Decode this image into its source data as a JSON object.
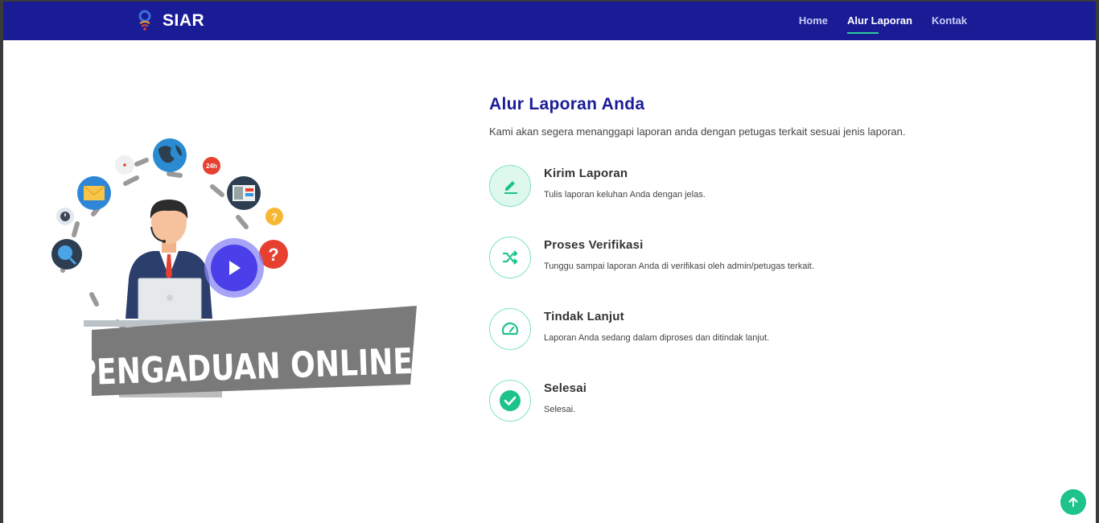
{
  "header": {
    "brand": "SIAR",
    "nav": [
      {
        "label": "Home"
      },
      {
        "label": "Alur Laporan"
      },
      {
        "label": "Kontak"
      }
    ]
  },
  "illustration": {
    "banner_text": "PENGADUAN ONLINE",
    "badge_24h": "24h"
  },
  "main": {
    "title": "Alur Laporan Anda",
    "description": "Kami akan segera menanggapi laporan anda dengan petugas terkait sesuai jenis laporan.",
    "steps": [
      {
        "title": "Kirim Laporan",
        "description": "Tulis laporan keluhan Anda dengan jelas.",
        "icon": "pencil-icon"
      },
      {
        "title": "Proses Verifikasi",
        "description": "Tunggu sampai laporan Anda di verifikasi oleh admin/petugas terkait.",
        "icon": "shuffle-icon"
      },
      {
        "title": "Tindak Lanjut",
        "description": "Laporan Anda sedang dalam diproses dan ditindak lanjut.",
        "icon": "speedometer-icon"
      },
      {
        "title": "Selesai",
        "description": "Selesai.",
        "icon": "check-circle-icon"
      }
    ]
  },
  "colors": {
    "navbar": "#1a1c96",
    "accent": "#1ec38c",
    "title": "#1a1c96"
  }
}
